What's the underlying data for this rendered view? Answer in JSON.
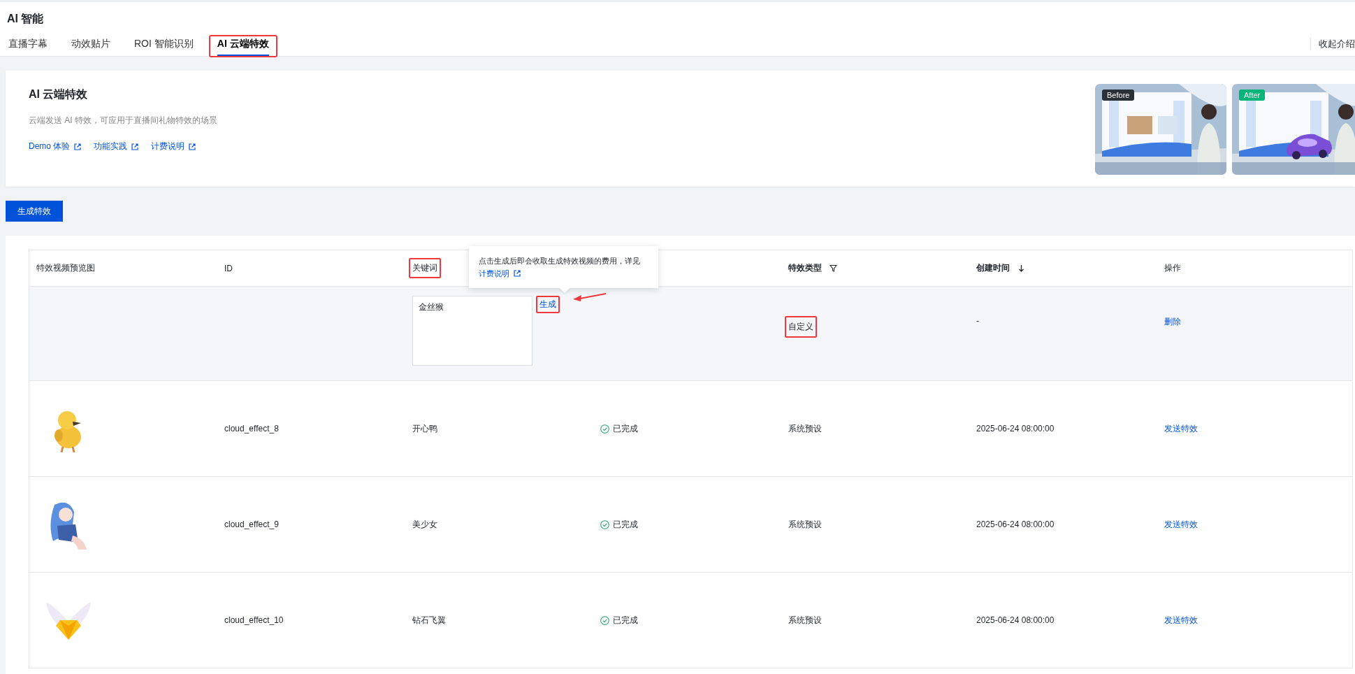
{
  "page": {
    "title": "AI 智能",
    "collapse_link": "收起介绍"
  },
  "tabs": [
    {
      "label": "直播字幕",
      "selected": false,
      "highlighted": false
    },
    {
      "label": "动效贴片",
      "selected": false,
      "highlighted": false
    },
    {
      "label": "ROI 智能识别",
      "selected": false,
      "highlighted": false
    },
    {
      "label": "AI 云端特效",
      "selected": true,
      "highlighted": true
    }
  ],
  "intro": {
    "title": "AI 云端特效",
    "description": "云端发送 AI 特效，可应用于直播间礼物特效的场景",
    "links": [
      "Demo 体验",
      "功能实践",
      "计费说明"
    ],
    "previews": [
      {
        "kind": "before",
        "badge": "Before"
      },
      {
        "kind": "after",
        "badge": "After"
      }
    ]
  },
  "create_button": "生成特效",
  "table": {
    "columns": [
      {
        "kind": "preview",
        "label": "特效视频预览图",
        "highlighted": false
      },
      {
        "kind": "id",
        "label": "ID",
        "highlighted": false
      },
      {
        "kind": "keyword",
        "label": "关键词",
        "highlighted": true
      },
      {
        "kind": "type",
        "label": "特效类型",
        "highlighted": false
      },
      {
        "kind": "created",
        "label": "创建时间",
        "highlighted": false
      },
      {
        "kind": "actions",
        "label": "操作",
        "highlighted": false
      }
    ],
    "tooltip": {
      "text": "点击生成后即会收取生成特效视频的费用，详见",
      "link": "计费说明"
    },
    "rows": [
      {
        "kind": "draft",
        "keyword_input": "金丝猴",
        "generate_link": "生成",
        "generate_highlighted": true,
        "generate_arrow": true,
        "type": "自定义",
        "type_highlighted": true,
        "created": "-",
        "action": "删除"
      },
      {
        "kind": "effect",
        "id": "cloud_effect_8",
        "keyword": "开心鸭",
        "status": "已完成",
        "type": "系统预设",
        "created": "2025-06-24 08:00:00",
        "action": "发送特效"
      },
      {
        "kind": "effect",
        "id": "cloud_effect_9",
        "keyword": "美少女",
        "status": "已完成",
        "type": "系统预设",
        "created": "2025-06-24 08:00:00",
        "action": "发送特效"
      },
      {
        "kind": "effect",
        "id": "cloud_effect_10",
        "keyword": "钻石飞翼",
        "status": "已完成",
        "type": "系统预设",
        "created": "2025-06-24 08:00:00",
        "action": "发送特效"
      }
    ]
  }
}
